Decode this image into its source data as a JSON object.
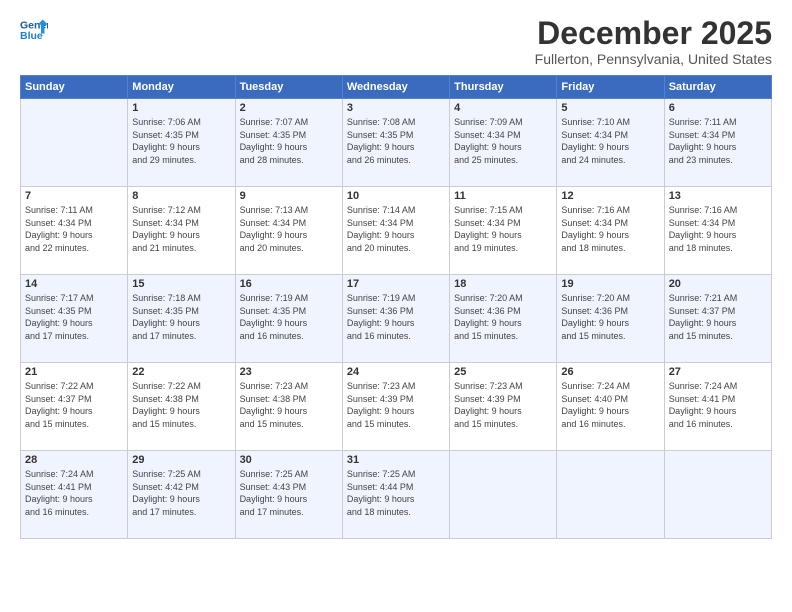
{
  "header": {
    "logo_line1": "General",
    "logo_line2": "Blue",
    "month": "December 2025",
    "location": "Fullerton, Pennsylvania, United States"
  },
  "days_of_week": [
    "Sunday",
    "Monday",
    "Tuesday",
    "Wednesday",
    "Thursday",
    "Friday",
    "Saturday"
  ],
  "weeks": [
    [
      {
        "day": "",
        "info": ""
      },
      {
        "day": "1",
        "info": "Sunrise: 7:06 AM\nSunset: 4:35 PM\nDaylight: 9 hours\nand 29 minutes."
      },
      {
        "day": "2",
        "info": "Sunrise: 7:07 AM\nSunset: 4:35 PM\nDaylight: 9 hours\nand 28 minutes."
      },
      {
        "day": "3",
        "info": "Sunrise: 7:08 AM\nSunset: 4:35 PM\nDaylight: 9 hours\nand 26 minutes."
      },
      {
        "day": "4",
        "info": "Sunrise: 7:09 AM\nSunset: 4:34 PM\nDaylight: 9 hours\nand 25 minutes."
      },
      {
        "day": "5",
        "info": "Sunrise: 7:10 AM\nSunset: 4:34 PM\nDaylight: 9 hours\nand 24 minutes."
      },
      {
        "day": "6",
        "info": "Sunrise: 7:11 AM\nSunset: 4:34 PM\nDaylight: 9 hours\nand 23 minutes."
      }
    ],
    [
      {
        "day": "7",
        "info": "Sunrise: 7:11 AM\nSunset: 4:34 PM\nDaylight: 9 hours\nand 22 minutes."
      },
      {
        "day": "8",
        "info": "Sunrise: 7:12 AM\nSunset: 4:34 PM\nDaylight: 9 hours\nand 21 minutes."
      },
      {
        "day": "9",
        "info": "Sunrise: 7:13 AM\nSunset: 4:34 PM\nDaylight: 9 hours\nand 20 minutes."
      },
      {
        "day": "10",
        "info": "Sunrise: 7:14 AM\nSunset: 4:34 PM\nDaylight: 9 hours\nand 20 minutes."
      },
      {
        "day": "11",
        "info": "Sunrise: 7:15 AM\nSunset: 4:34 PM\nDaylight: 9 hours\nand 19 minutes."
      },
      {
        "day": "12",
        "info": "Sunrise: 7:16 AM\nSunset: 4:34 PM\nDaylight: 9 hours\nand 18 minutes."
      },
      {
        "day": "13",
        "info": "Sunrise: 7:16 AM\nSunset: 4:34 PM\nDaylight: 9 hours\nand 18 minutes."
      }
    ],
    [
      {
        "day": "14",
        "info": "Sunrise: 7:17 AM\nSunset: 4:35 PM\nDaylight: 9 hours\nand 17 minutes."
      },
      {
        "day": "15",
        "info": "Sunrise: 7:18 AM\nSunset: 4:35 PM\nDaylight: 9 hours\nand 17 minutes."
      },
      {
        "day": "16",
        "info": "Sunrise: 7:19 AM\nSunset: 4:35 PM\nDaylight: 9 hours\nand 16 minutes."
      },
      {
        "day": "17",
        "info": "Sunrise: 7:19 AM\nSunset: 4:36 PM\nDaylight: 9 hours\nand 16 minutes."
      },
      {
        "day": "18",
        "info": "Sunrise: 7:20 AM\nSunset: 4:36 PM\nDaylight: 9 hours\nand 15 minutes."
      },
      {
        "day": "19",
        "info": "Sunrise: 7:20 AM\nSunset: 4:36 PM\nDaylight: 9 hours\nand 15 minutes."
      },
      {
        "day": "20",
        "info": "Sunrise: 7:21 AM\nSunset: 4:37 PM\nDaylight: 9 hours\nand 15 minutes."
      }
    ],
    [
      {
        "day": "21",
        "info": "Sunrise: 7:22 AM\nSunset: 4:37 PM\nDaylight: 9 hours\nand 15 minutes."
      },
      {
        "day": "22",
        "info": "Sunrise: 7:22 AM\nSunset: 4:38 PM\nDaylight: 9 hours\nand 15 minutes."
      },
      {
        "day": "23",
        "info": "Sunrise: 7:23 AM\nSunset: 4:38 PM\nDaylight: 9 hours\nand 15 minutes."
      },
      {
        "day": "24",
        "info": "Sunrise: 7:23 AM\nSunset: 4:39 PM\nDaylight: 9 hours\nand 15 minutes."
      },
      {
        "day": "25",
        "info": "Sunrise: 7:23 AM\nSunset: 4:39 PM\nDaylight: 9 hours\nand 15 minutes."
      },
      {
        "day": "26",
        "info": "Sunrise: 7:24 AM\nSunset: 4:40 PM\nDaylight: 9 hours\nand 16 minutes."
      },
      {
        "day": "27",
        "info": "Sunrise: 7:24 AM\nSunset: 4:41 PM\nDaylight: 9 hours\nand 16 minutes."
      }
    ],
    [
      {
        "day": "28",
        "info": "Sunrise: 7:24 AM\nSunset: 4:41 PM\nDaylight: 9 hours\nand 16 minutes."
      },
      {
        "day": "29",
        "info": "Sunrise: 7:25 AM\nSunset: 4:42 PM\nDaylight: 9 hours\nand 17 minutes."
      },
      {
        "day": "30",
        "info": "Sunrise: 7:25 AM\nSunset: 4:43 PM\nDaylight: 9 hours\nand 17 minutes."
      },
      {
        "day": "31",
        "info": "Sunrise: 7:25 AM\nSunset: 4:44 PM\nDaylight: 9 hours\nand 18 minutes."
      },
      {
        "day": "",
        "info": ""
      },
      {
        "day": "",
        "info": ""
      },
      {
        "day": "",
        "info": ""
      }
    ]
  ]
}
